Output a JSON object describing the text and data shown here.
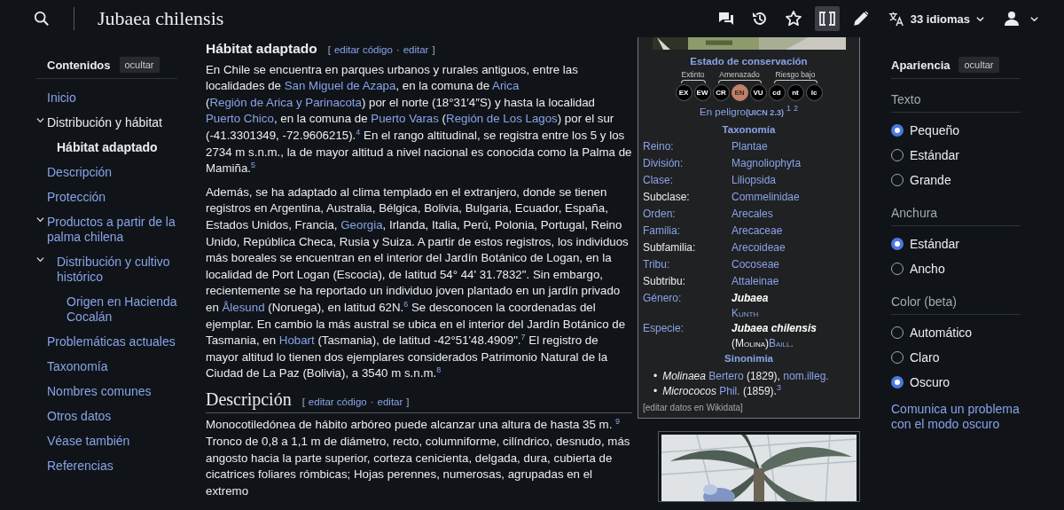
{
  "header": {
    "title": "Jubaea chilensis",
    "tools": [
      {
        "kind": "talk",
        "selected": false
      },
      {
        "kind": "history",
        "selected": false
      },
      {
        "kind": "watch",
        "selected": false
      },
      {
        "kind": "wikitext",
        "selected": true
      },
      {
        "kind": "edit",
        "selected": false
      }
    ],
    "languages": "33 idiomas"
  },
  "toc": {
    "title": "Contenidos",
    "hide": "ocultar",
    "items": [
      {
        "label": "Inicio",
        "selected": false
      },
      {
        "label": "Distribución y hábitat",
        "selected": false,
        "expanded": true,
        "children": [
          {
            "label": "Hábitat adaptado",
            "selected": true
          }
        ]
      },
      {
        "label": "Descripción",
        "selected": false
      },
      {
        "label": "Protección",
        "selected": false
      },
      {
        "label": "Productos a partir de la palma chilena",
        "selected": false,
        "expanded": true,
        "children": [
          {
            "label": "Distribución y cultivo histórico",
            "selected": false,
            "expanded": true,
            "children": [
              {
                "label": "Origen en Hacienda Cocalán",
                "selected": false
              }
            ]
          }
        ]
      },
      {
        "label": "Problemáticas actuales",
        "selected": false
      },
      {
        "label": "Taxonomía",
        "selected": false
      },
      {
        "label": "Nombres comunes",
        "selected": false
      },
      {
        "label": "Otros datos",
        "selected": false
      },
      {
        "label": "Véase también",
        "selected": false
      },
      {
        "label": "Referencias",
        "selected": false
      }
    ]
  },
  "sections": [
    {
      "kind": "subsection",
      "heading": "Hábitat adaptado",
      "edit": {
        "open": "[",
        "links": [
          "editar código",
          "editar"
        ],
        "separator": "·",
        "close": "]"
      },
      "paragraphs": [
        [
          {
            "kind": "text",
            "t": "En Chile se encuentra en parques urbanos y rurales antiguos, entre las localidades de "
          },
          {
            "kind": "link",
            "t": "San Miguel de Azapa"
          },
          {
            "kind": "text",
            "t": ", en la comuna de "
          },
          {
            "kind": "link",
            "t": "Arica"
          },
          {
            "kind": "text",
            "t": " ("
          },
          {
            "kind": "link",
            "t": "Región de Arica y Parinacota"
          },
          {
            "kind": "text",
            "t": ") por el norte (18°31′4″S) y hasta la localidad "
          },
          {
            "kind": "link",
            "t": "Puerto Chico"
          },
          {
            "kind": "text",
            "t": ", en la comuna de "
          },
          {
            "kind": "link",
            "t": "Puerto Varas"
          },
          {
            "kind": "text",
            "t": " ("
          },
          {
            "kind": "link",
            "t": "Región de Los Lagos"
          },
          {
            "kind": "text",
            "t": ") por el sur (-41.3301349, -72.9606215)."
          },
          {
            "kind": "ref",
            "t": "4"
          },
          {
            "kind": "text",
            "t": "  En el rango altitudinal, se registra entre los 5 y los 2734 m s.n.m., la de mayor altitud a nivel nacional es conocida como la Palma de Mamiña."
          },
          {
            "kind": "ref",
            "t": "5"
          }
        ],
        [
          {
            "kind": "text",
            "t": "Además, se ha adaptado al clima templado en el extranjero, donde se tienen registros en Argentina, Australia, Bélgica, Bolivia, Bulgaria, Ecuador, España, Estados Unidos, Francia, "
          },
          {
            "kind": "link",
            "t": "Georgia"
          },
          {
            "kind": "text",
            "t": ", Irlanda, Italia, Perú, Polonia, Portugal, Reino Unido, República Checa, Rusia y Suiza. A partir de estos registros, los individuos más boreales se encuentran en el interior del Jardín Botánico de Logan, en la localidad de Port Logan (Escocia), de latitud 54° 44' 31.7832\". Sin embargo, recientemente se ha reportado un individuo joven plantado en un jardín privado en "
          },
          {
            "kind": "link",
            "t": "Ålesund"
          },
          {
            "kind": "text",
            "t": " (Noruega), en latitud 62N."
          },
          {
            "kind": "ref",
            "t": "6"
          },
          {
            "kind": "text",
            "t": "  Se desconocen la coordenadas del ejemplar. En cambio la más austral se ubica en el interior del Jardín Botánico de Tasmania, en "
          },
          {
            "kind": "link",
            "t": "Hobart"
          },
          {
            "kind": "text",
            "t": " (Tasmania), de latitud -42°51'48.4909\"."
          },
          {
            "kind": "ref",
            "t": "7"
          },
          {
            "kind": "text",
            "t": "  El registro de mayor altitud lo tienen dos ejemplares considerados Patrimonio Natural de la Ciudad de La Paz (Bolivia), a 3540 m s.n.m."
          },
          {
            "kind": "ref",
            "t": "8"
          }
        ]
      ]
    },
    {
      "kind": "section",
      "heading": "Descripción",
      "edit": {
        "open": "[",
        "links": [
          "editar código",
          "editar"
        ],
        "separator": "·",
        "close": "]"
      },
      "paragraphs": [
        [
          {
            "kind": "text",
            "t": "Monocotiledónea de hábito arbóreo puede alcanzar una altura de hasta 35 m. "
          },
          {
            "kind": "ref",
            "t": "9"
          },
          {
            "kind": "text",
            "t": " Tronco de 0,8 a 1,1 m de diámetro, recto, columniforme, cilíndrico, desnudo, más angosto hacia la parte superior, corteza cenicienta, delgada, dura, cubierta de cicatrices foliares rómbicas; Hojas perennes, numerosas, agrupadas en el extremo"
          }
        ]
      ]
    }
  ],
  "infobox": {
    "conservation": {
      "title": "Estado de conservación",
      "groups": [
        {
          "label": "Extinto",
          "statuses": [
            {
              "code": "EX",
              "selected": false
            },
            {
              "code": "EW",
              "selected": false
            }
          ]
        },
        {
          "label": "Amenazado",
          "statuses": [
            {
              "code": "CR",
              "selected": false
            },
            {
              "code": "EN",
              "selected": true
            },
            {
              "code": "VU",
              "selected": false
            }
          ]
        },
        {
          "label": "Riesgo bajo",
          "statuses": [
            {
              "code": "cd",
              "selected": false
            },
            {
              "code": "nt",
              "selected": false
            },
            {
              "code": "lc",
              "selected": false
            }
          ]
        }
      ],
      "status": "En peligro",
      "source": "(UICN 2.3)",
      "refs": [
        "1",
        "2"
      ]
    },
    "taxonomy_title": "Taxonomía",
    "taxonomy": [
      {
        "rank": "Reino:",
        "rank_linked": true,
        "value": [
          {
            "kind": "link",
            "t": "Plantae"
          }
        ]
      },
      {
        "rank": "División:",
        "rank_linked": true,
        "value": [
          {
            "kind": "link",
            "t": "Magnoliophyta"
          }
        ]
      },
      {
        "rank": "Clase:",
        "rank_linked": true,
        "value": [
          {
            "kind": "link",
            "t": "Liliopsida"
          }
        ]
      },
      {
        "rank": "Subclase:",
        "rank_linked": false,
        "value": [
          {
            "kind": "link",
            "t": "Commelinidae"
          }
        ]
      },
      {
        "rank": "Orden:",
        "rank_linked": true,
        "value": [
          {
            "kind": "link",
            "t": "Arecales"
          }
        ]
      },
      {
        "rank": "Familia:",
        "rank_linked": true,
        "value": [
          {
            "kind": "link",
            "t": "Arecaceae"
          }
        ]
      },
      {
        "rank": "Subfamilia:",
        "rank_linked": false,
        "value": [
          {
            "kind": "link",
            "t": "Arecoideae"
          }
        ]
      },
      {
        "rank": "Tribu:",
        "rank_linked": true,
        "value": [
          {
            "kind": "link",
            "t": "Cocoseae"
          }
        ]
      },
      {
        "rank": "Subtribu:",
        "rank_linked": false,
        "value": [
          {
            "kind": "link",
            "t": "Attaleinae"
          }
        ]
      },
      {
        "rank": "Género:",
        "rank_linked": true,
        "value": [
          {
            "kind": "name",
            "t": "Jubaea"
          }
        ],
        "authority": [
          {
            "kind": "sc-link",
            "t": "Kunth"
          }
        ]
      },
      {
        "rank": "Especie:",
        "rank_linked": true,
        "value": [
          {
            "kind": "name",
            "t": "Jubaea chilensis"
          }
        ],
        "authority": [
          {
            "kind": "sc-text",
            "t": "(Molina)"
          },
          {
            "kind": "sc-link",
            "t": "Baill."
          }
        ]
      }
    ],
    "synonyms_title": "Sinonimia",
    "synonyms": [
      {
        "bullet": "•",
        "parts": [
          {
            "kind": "italic",
            "t": "Molinaea "
          },
          {
            "kind": "link",
            "t": "Bertero"
          },
          {
            "kind": "text",
            "t": " (1829), "
          },
          {
            "kind": "link",
            "t": "nom.illeg."
          }
        ]
      },
      {
        "bullet": "•",
        "parts": [
          {
            "kind": "italic",
            "t": "Micrococos "
          },
          {
            "kind": "link",
            "t": "Phil."
          },
          {
            "kind": "text",
            "t": " (1859)."
          },
          {
            "kind": "ref",
            "t": "3"
          }
        ]
      }
    ],
    "wikidata": "[editar datos en Wikidata]"
  },
  "appearance": {
    "title": "Apariencia",
    "hide": "ocultar",
    "groups": [
      {
        "label": "Texto",
        "options": [
          {
            "label": "Pequeño",
            "selected": true
          },
          {
            "label": "Estándar",
            "selected": false
          },
          {
            "label": "Grande",
            "selected": false
          }
        ]
      },
      {
        "label": "Anchura",
        "options": [
          {
            "label": "Estándar",
            "selected": true
          },
          {
            "label": "Ancho",
            "selected": false
          }
        ]
      },
      {
        "label": "Color (beta)",
        "options": [
          {
            "label": "Automático",
            "selected": false
          },
          {
            "label": "Claro",
            "selected": false
          },
          {
            "label": "Oscuro",
            "selected": true
          }
        ]
      }
    ],
    "report": "Comunica un problema con el modo oscuro"
  }
}
